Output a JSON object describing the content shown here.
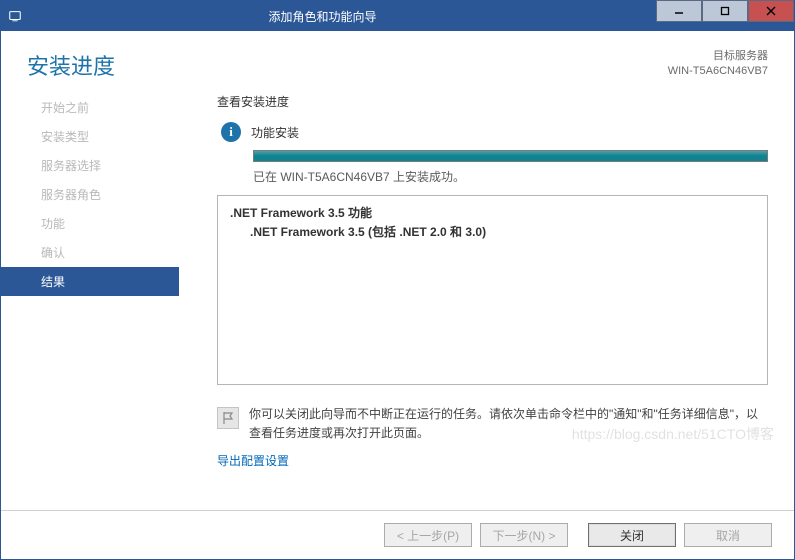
{
  "window": {
    "title": "添加角色和功能向导"
  },
  "header": {
    "heading": "安装进度",
    "target_label": "目标服务器",
    "target_server": "WIN-T5A6CN46VB7"
  },
  "sidebar": {
    "items": [
      {
        "label": "开始之前"
      },
      {
        "label": "安装类型"
      },
      {
        "label": "服务器选择"
      },
      {
        "label": "服务器角色"
      },
      {
        "label": "功能"
      },
      {
        "label": "确认"
      },
      {
        "label": "结果"
      }
    ],
    "active_index": 6
  },
  "content": {
    "subhead": "查看安装进度",
    "status_text": "功能安装",
    "progress_percent": 100,
    "success_text": "已在 WIN-T5A6CN46VB7 上安装成功。",
    "features": {
      "line1": ".NET Framework 3.5 功能",
      "line2": ".NET Framework 3.5 (包括 .NET 2.0 和 3.0)"
    },
    "note_text": "你可以关闭此向导而不中断正在运行的任务。请依次单击命令栏中的\"通知\"和\"任务详细信息\"，以查看任务进度或再次打开此页面。",
    "export_link": "导出配置设置"
  },
  "footer": {
    "previous": "< 上一步(P)",
    "next": "下一步(N) >",
    "close": "关闭",
    "cancel": "取消"
  },
  "watermark": "https://blog.csdn.net/51CTO博客"
}
